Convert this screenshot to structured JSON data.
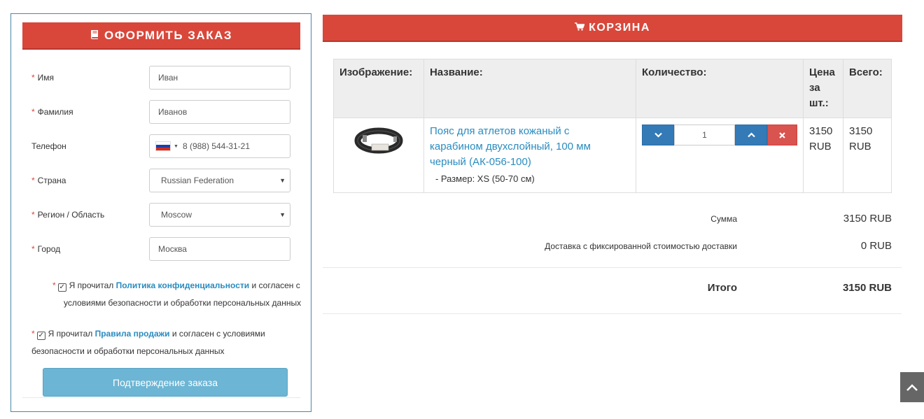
{
  "order": {
    "title": "ОФОРМИТЬ ЗАКАЗ",
    "fields": {
      "first_name": {
        "label": "Имя",
        "value": "Иван"
      },
      "last_name": {
        "label": "Фамилия",
        "value": "Иванов"
      },
      "phone": {
        "label": "Телефон",
        "value": "8 (988) 544-31-21"
      },
      "country": {
        "label": "Страна",
        "value": "Russian Federation"
      },
      "region": {
        "label": "Регион / Область",
        "value": "Moscow"
      },
      "city": {
        "label": "Город",
        "value": "Москва"
      }
    },
    "privacy": {
      "prefix": "Я прочитал",
      "link": "Политика конфиденциальности",
      "suffix": "и согласен с",
      "line2": "условиями безопасности и обработки персональных данных"
    },
    "terms": {
      "prefix": "Я прочитал",
      "link": "Правила продажи",
      "suffix": "и согласен с условиями",
      "line2": "безопасности и обработки персональных данных"
    },
    "confirm_label": "Подтверждение заказа"
  },
  "cart": {
    "title": "КОРЗИНА",
    "headers": {
      "image": "Изображение:",
      "name": "Название:",
      "qty": "Количество:",
      "price_l1": "Цена",
      "price_l2": "за",
      "price_l3": "шт.:",
      "total": "Всего:"
    },
    "item": {
      "name_l1": "Пояс для атлетов кожаный с",
      "name_l2": "карабином двухслойный, 100 мм",
      "name_l3": "черный (АК-056-100)",
      "option": "- Размер: XS (50-70 см)",
      "qty": "1",
      "price_num": "3150",
      "price_cur": "RUB",
      "total_num": "3150",
      "total_cur": "RUB"
    },
    "sum_label": "Сумма",
    "sum_value": "3150 RUB",
    "delivery_label": "Доставка с фиксированной стоимостью доставки",
    "delivery_value": "0 RUB",
    "total_label": "Итого",
    "total_value": "3150 RUB"
  },
  "colors": {
    "accent": "#d9473b",
    "link": "#2a8cc0",
    "confirm": "#6cb5d4",
    "qty_blue": "#337ab7",
    "remove_red": "#d9534f"
  }
}
